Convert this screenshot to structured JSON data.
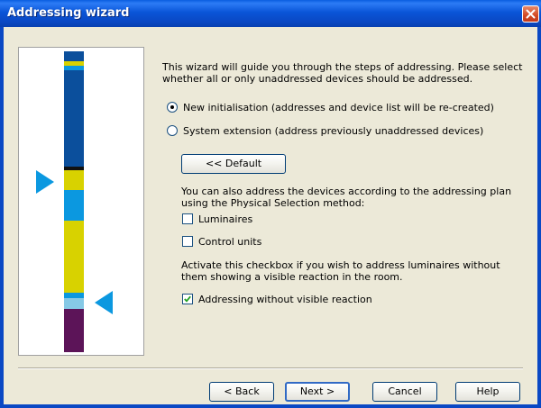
{
  "window": {
    "title": "Addressing wizard"
  },
  "intro": {
    "line1": "This wizard will guide you through the steps of addressing. Please select",
    "line2": "whether all or only unaddressed devices should be addressed."
  },
  "options": {
    "new_init": {
      "label": "New initialisation (addresses and device list will be re-created)",
      "selected": true
    },
    "system_ext": {
      "label": "System extension (address previously unaddressed devices)",
      "selected": false
    }
  },
  "default_button": "<< Default",
  "physical": {
    "line1": "You can also address the devices according to the addressing plan",
    "line2": "using the Physical Selection method:",
    "luminaires": {
      "label": "Luminaires",
      "checked": false
    },
    "control_units": {
      "label": "Control units",
      "checked": false
    }
  },
  "visible": {
    "line1": "Activate this checkbox if you wish to address luminaires without",
    "line2": "them showing a visible reaction in the room.",
    "checkbox": {
      "label": "Addressing without visible reaction",
      "checked": true
    }
  },
  "footer": {
    "back": "< Back",
    "next": "Next >",
    "cancel": "Cancel",
    "help": "Help"
  },
  "colors": {
    "title_bar": "#0a55d8",
    "dark_blue": "#0b4f9c",
    "yellow": "#d8d200",
    "cyan": "#0b98e0",
    "light_cyan": "#86c9e6",
    "purple": "#5c1458",
    "black": "#111111",
    "arrow": "#0b98e0"
  }
}
